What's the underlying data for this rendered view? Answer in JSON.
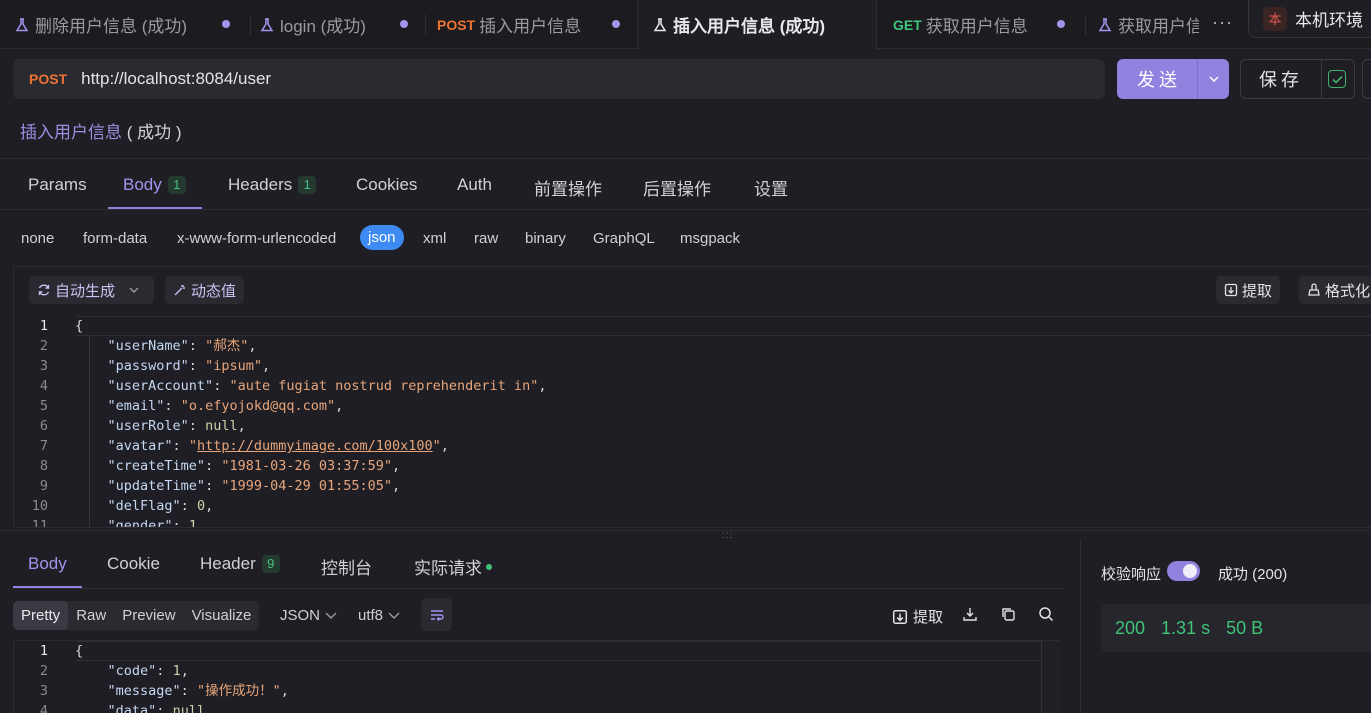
{
  "tabs": [
    {
      "label": "删除用户信息 (成功)",
      "method": ""
    },
    {
      "label": "login (成功)",
      "method": ""
    },
    {
      "label": "插入用户信息",
      "method": "POST"
    },
    {
      "label": "插入用户信息 (成功)",
      "method": ""
    },
    {
      "label": "获取用户信息",
      "method": "GET"
    },
    {
      "label": "获取用户信",
      "method": ""
    }
  ],
  "more_label": "···",
  "env": {
    "badge": "本",
    "label": "本机环境"
  },
  "request": {
    "method": "POST",
    "url": "http://localhost:8084/user",
    "send_label": "发送",
    "save_label": "保存",
    "name": "插入用户信息",
    "status": "( 成功 )"
  },
  "req_tabs": [
    {
      "label": "Params",
      "count": ""
    },
    {
      "label": "Body",
      "count": "1"
    },
    {
      "label": "Headers",
      "count": "1"
    },
    {
      "label": "Cookies",
      "count": ""
    },
    {
      "label": "Auth",
      "count": ""
    },
    {
      "label": "前置操作",
      "count": ""
    },
    {
      "label": "后置操作",
      "count": ""
    },
    {
      "label": "设置",
      "count": ""
    }
  ],
  "body_types": [
    "none",
    "form-data",
    "x-www-form-urlencoded",
    "json",
    "xml",
    "raw",
    "binary",
    "GraphQL",
    "msgpack"
  ],
  "editor_toolbar": {
    "auto_gen": "自动生成",
    "dynamic": "动态值",
    "extract": "提取",
    "format": "格式化"
  },
  "body_json": {
    "userName": "郝杰",
    "password": "ipsum",
    "userAccount": "aute fugiat nostrud reprehenderit in",
    "email": "o.efyojokd@qq.com",
    "userRole": "null",
    "avatar": "http://dummyimage.com/100x100",
    "createTime": "1981-03-26 03:37:59",
    "updateTime": "1999-04-29 01:55:05",
    "delFlag": "0",
    "gender": "1"
  },
  "response": {
    "tabs": [
      {
        "label": "Body",
        "count": ""
      },
      {
        "label": "Cookie",
        "count": ""
      },
      {
        "label": "Header",
        "count": "9"
      },
      {
        "label": "控制台",
        "count": ""
      },
      {
        "label": "实际请求",
        "count": ""
      }
    ],
    "views": [
      "Pretty",
      "Raw",
      "Preview",
      "Visualize"
    ],
    "format": "JSON",
    "encoding": "utf8",
    "extract": "提取",
    "json": {
      "code": "1",
      "message": "操作成功！",
      "data": "null"
    },
    "validate_label": "校验响应",
    "validate_status": "成功 (200)",
    "status_code": "200",
    "time": "1.31 s",
    "size": "50 B"
  },
  "colors": {
    "accent": "#9182e0",
    "post": "#ed7334",
    "get": "#3fc47a",
    "json_chip": "#3d8bf2"
  }
}
